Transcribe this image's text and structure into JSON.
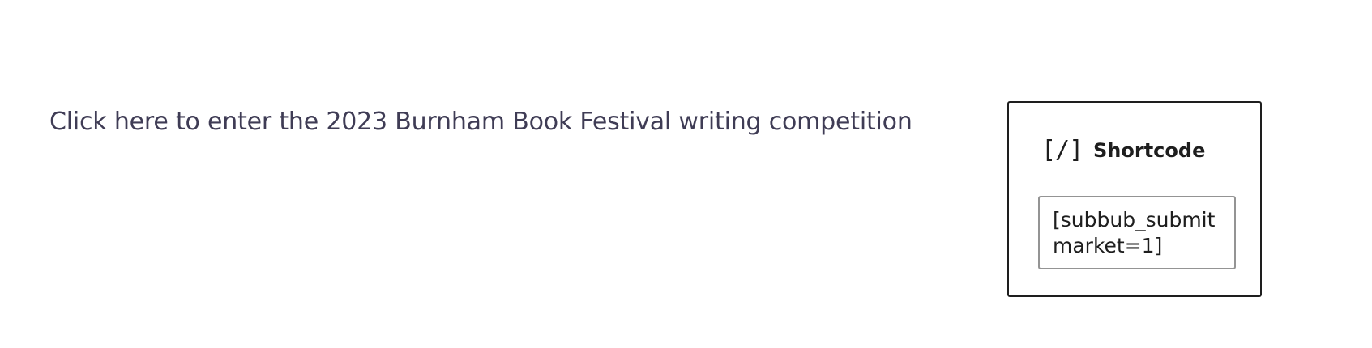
{
  "editor": {
    "paragraph": {
      "text": "Click here to enter the 2023 Burnham Book Festival writing competition"
    },
    "shortcode_block": {
      "icon": "shortcode-icon",
      "icon_glyph": "[/]",
      "title": "Shortcode",
      "value": "[subbub_submit market=1]"
    }
  },
  "colors": {
    "paragraph_text": "#3f3c55",
    "block_border": "#1e1e1e",
    "input_border": "#949494",
    "title_text": "#1e1e1e"
  }
}
